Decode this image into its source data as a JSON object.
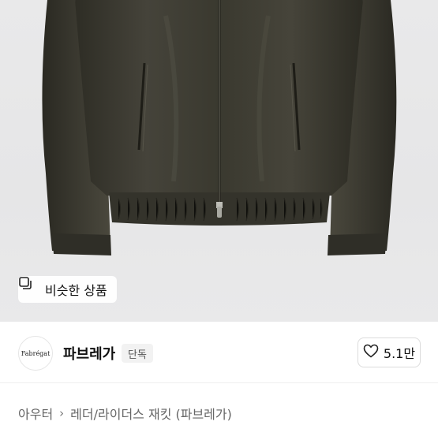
{
  "product": {
    "similar_button_label": "비슷한 상품"
  },
  "shop": {
    "logo_text": "Fabrégat",
    "name": "파브레가",
    "badge": "단독",
    "like_count": "5.1만"
  },
  "breadcrumb": {
    "items": [
      "아우터",
      "레더/라이더스 재킷 (파브레가)"
    ]
  },
  "icons": {
    "similar": "stacked-squares-icon",
    "like": "heart-outline-icon",
    "separator": "chevron-right-icon"
  },
  "colors": {
    "photo_background": "#e7e7e8",
    "jacket_leather": "#3b3a30"
  }
}
